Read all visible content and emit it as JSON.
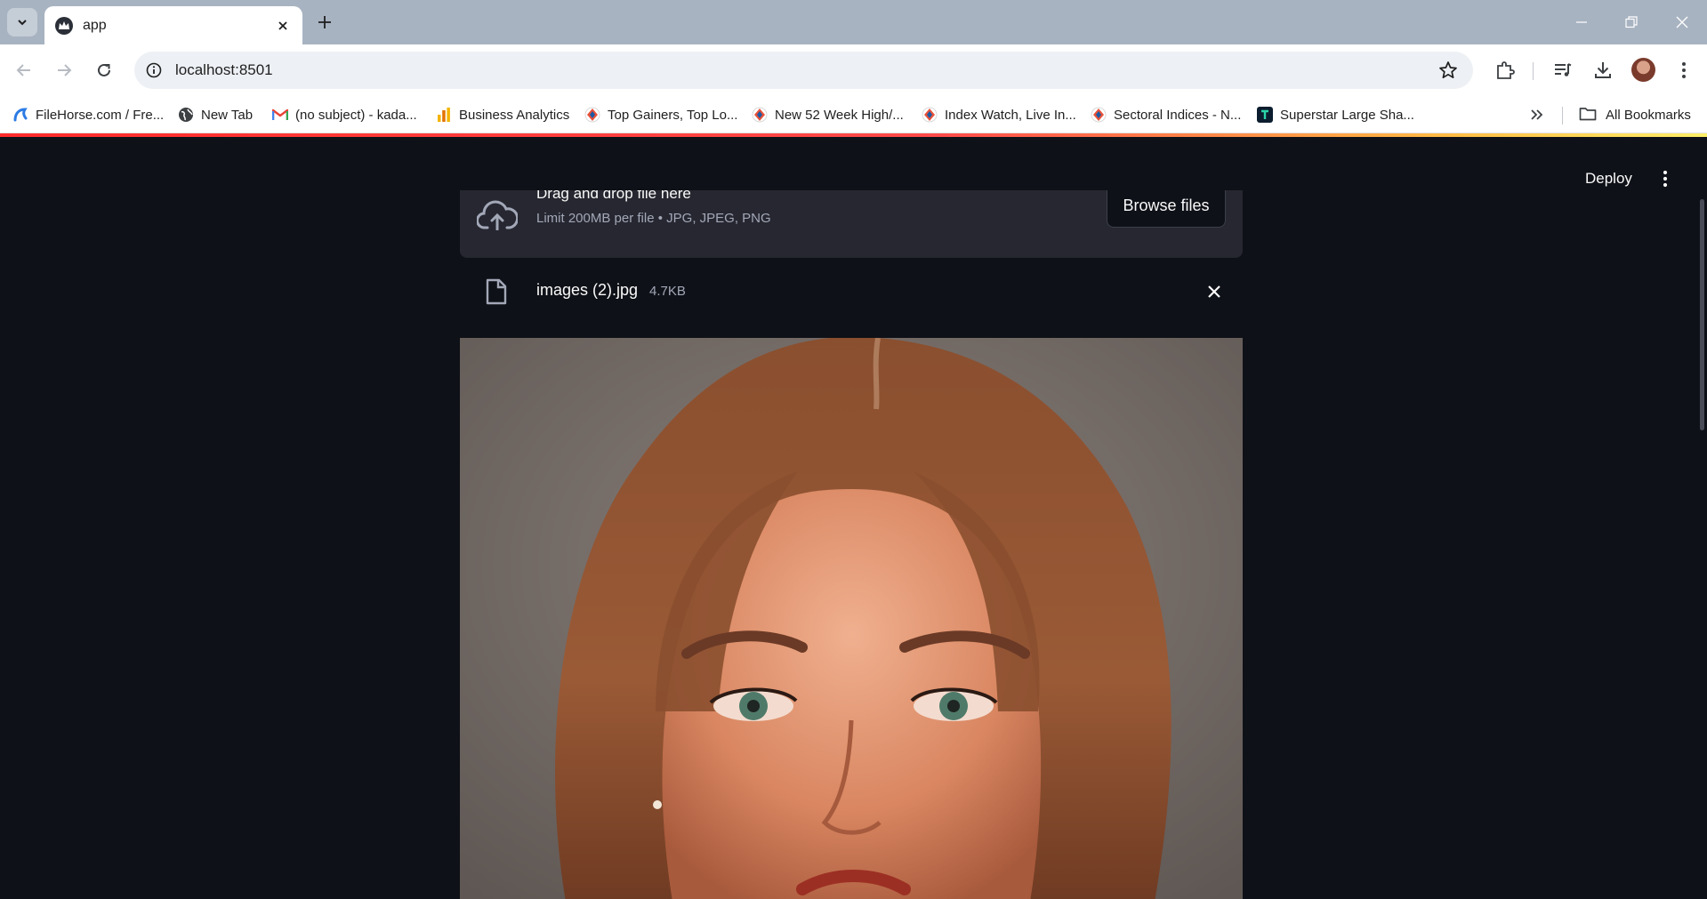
{
  "browser": {
    "tab": {
      "title": "app"
    },
    "address_bar": {
      "url": "localhost:8501"
    },
    "bookmarks": [
      {
        "label": "FileHorse.com / Fre..."
      },
      {
        "label": "New Tab"
      },
      {
        "label": "(no subject) - kada..."
      },
      {
        "label": "Business Analytics"
      },
      {
        "label": "Top Gainers, Top Lo..."
      },
      {
        "label": "New 52 Week High/..."
      },
      {
        "label": "Index Watch, Live In..."
      },
      {
        "label": "Sectoral Indices - N..."
      },
      {
        "label": "Superstar Large Sha..."
      }
    ],
    "all_bookmarks_label": "All Bookmarks"
  },
  "app": {
    "header": {
      "deploy_label": "Deploy"
    },
    "uploader": {
      "title": "Drag and drop file here",
      "limit_text": "Limit 200MB per file • JPG, JPEG, PNG",
      "browse_label": "Browse files"
    },
    "uploaded_file": {
      "name": "images (2).jpg",
      "size": "4.7KB"
    }
  },
  "colors": {
    "app_background": "#0e1117",
    "dropzone_background": "#262730",
    "text_primary": "#fafafa",
    "text_secondary": "#a3a8b8",
    "accent": "#ff4b4b"
  }
}
